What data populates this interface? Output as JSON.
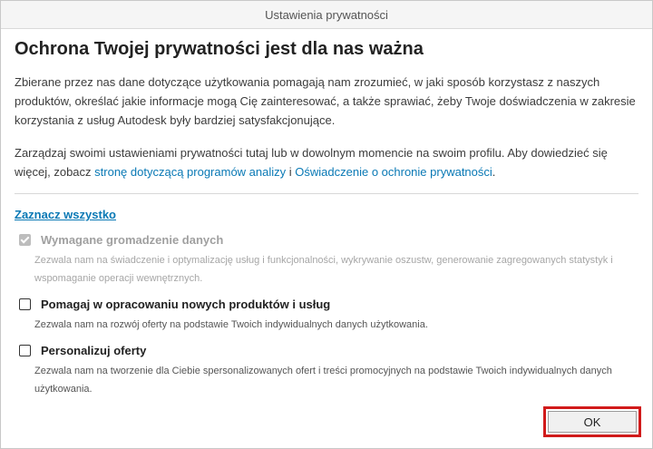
{
  "window": {
    "title": "Ustawienia prywatności"
  },
  "heading": "Ochrona Twojej prywatności jest dla nas ważna",
  "intro_paragraph": "Zbierane przez nas dane dotyczące użytkowania pomagają nam zrozumieć, w jaki sposób korzystasz z naszych produktów, określać jakie informacje mogą Cię zainteresować, a także sprawiać, żeby Twoje doświadczenia w zakresie korzystania z usług Autodesk były bardziej satysfakcjonujące.",
  "manage_paragraph": {
    "text_before": "Zarządzaj swoimi ustawieniami prywatności tutaj lub w dowolnym momencie na swoim profilu. Aby dowiedzieć się więcej, zobacz ",
    "link1": "stronę dotyczącą programów analizy",
    "text_between": " i ",
    "link2": "Oświadczenie o ochronie prywatności",
    "text_after": "."
  },
  "select_all": "Zaznacz wszystko",
  "options": [
    {
      "title": "Wymagane gromadzenie danych",
      "description": "Zezwala nam na świadczenie i optymalizację usług i funkcjonalności, wykrywanie oszustw, generowanie zagregowanych statystyk i wspomaganie operacji wewnętrznych.",
      "checked": true,
      "disabled": true
    },
    {
      "title": "Pomagaj w opracowaniu nowych produktów i usług",
      "description": "Zezwala nam na rozwój oferty na podstawie Twoich indywidualnych danych użytkowania.",
      "checked": false,
      "disabled": false
    },
    {
      "title": "Personalizuj oferty",
      "description": "Zezwala nam na tworzenie dla Ciebie spersonalizowanych ofert i treści promocyjnych na podstawie Twoich indywidualnych danych użytkowania.",
      "checked": false,
      "disabled": false
    }
  ],
  "ok_button": "OK",
  "colors": {
    "link": "#0a79b5",
    "highlight_border": "#d11a1a",
    "disabled_text": "#a0a0a0"
  }
}
